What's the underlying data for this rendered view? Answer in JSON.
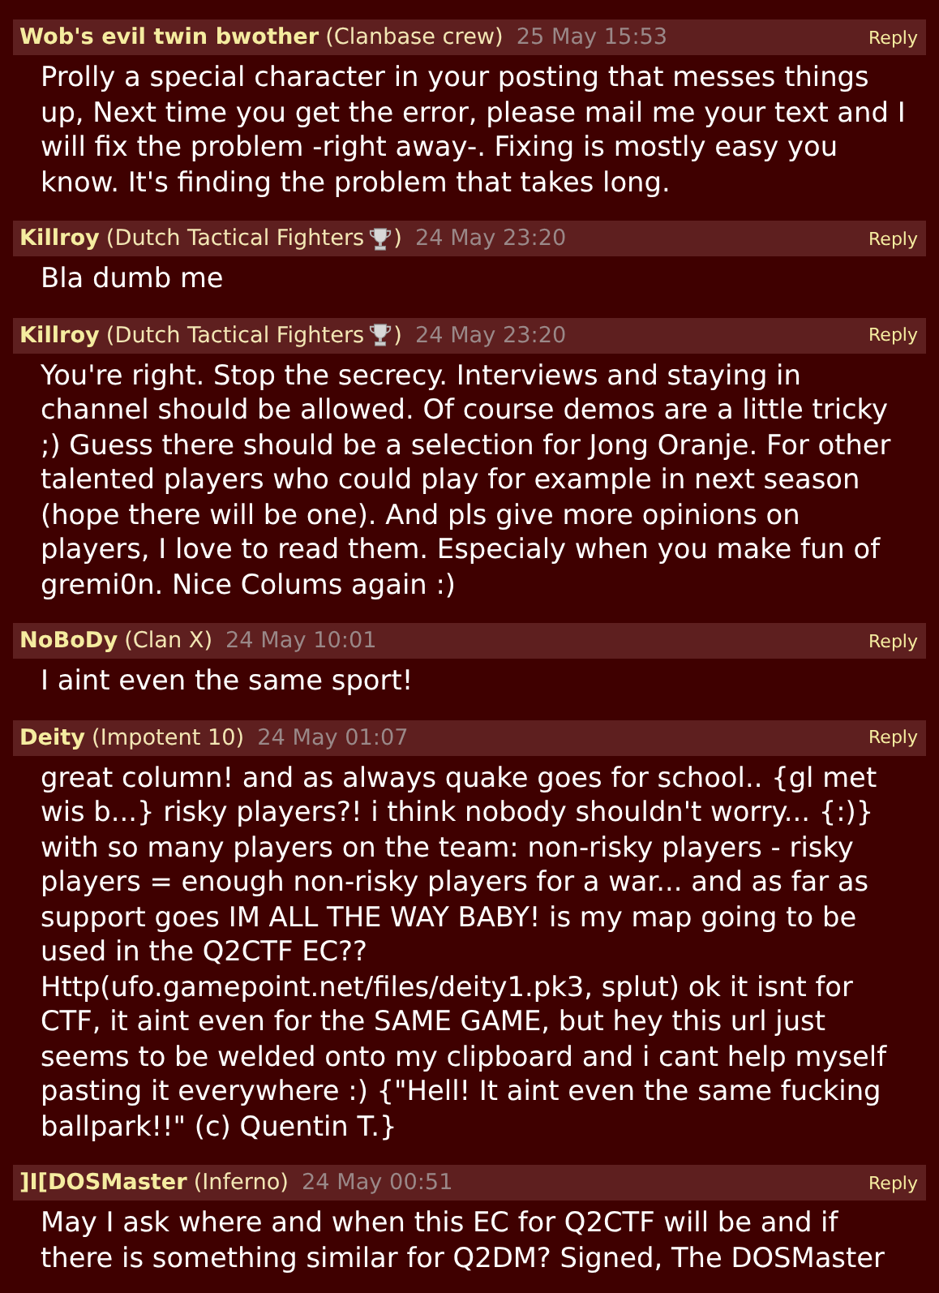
{
  "posts": [
    {
      "author": "Wob's evil twin bwother",
      "clan": "(Clanbase crew)",
      "trophy": false,
      "date": "25 May 15:53",
      "reply": "Reply",
      "body": "Prolly a special character in your posting that messes things up, Next time you get the error, please mail me your text and I will fix the problem -right away-. Fixing is mostly easy you know. It's finding the problem that takes long."
    },
    {
      "author": "Killroy",
      "clan": "(Dutch Tactical Fighters",
      "trophy": true,
      "clan_end": ")",
      "date": "24 May 23:20",
      "reply": "Reply",
      "body": "Bla dumb me"
    },
    {
      "author": "Killroy",
      "clan": "(Dutch Tactical Fighters",
      "trophy": true,
      "clan_end": ")",
      "date": "24 May 23:20",
      "reply": "Reply",
      "body": "You're right. Stop the secrecy. Interviews and staying in channel should be allowed. Of course demos are a little tricky ;) Guess there should be a selection for Jong Oranje. For other talented players who could play for example in next season (hope there will be one). And pls give more opinions on players, I love to read them. Especialy when you make fun of gremi0n. Nice Colums again :)"
    },
    {
      "author": "NoBoDy",
      "clan": "(Clan X)",
      "trophy": false,
      "date": "24 May 10:01",
      "reply": "Reply",
      "body": "I aint even the same sport!"
    },
    {
      "author": "Deity",
      "clan": "(Impotent 10)",
      "trophy": false,
      "date": "24 May 01:07",
      "reply": "Reply",
      "body": "great column! and as always quake goes for school.. {gl met wis b...} risky players?! i think nobody shouldn't worry... {:)} with so many players on the team: non-risky players - risky players = enough non-risky players for a war... and as far as support goes IM ALL THE WAY BABY! is my map going to be used in the Q2CTF EC?? Http(ufo.gamepoint.net/files/deity1.pk3, splut) ok it isnt for CTF, it aint even for the SAME GAME, but hey this url just seems to be welded onto my clipboard and i cant help myself pasting it everywhere :) {\"Hell! It aint even the same fucking ballpark!!\" (c) Quentin T.}"
    },
    {
      "author": "]I[DOSMaster",
      "clan": "(Inferno)",
      "trophy": false,
      "date": "24 May 00:51",
      "reply": "Reply",
      "body": "May I ask where and when this EC for Q2CTF will be and if there is something similar for Q2DM? Signed, The DOSMaster"
    }
  ]
}
